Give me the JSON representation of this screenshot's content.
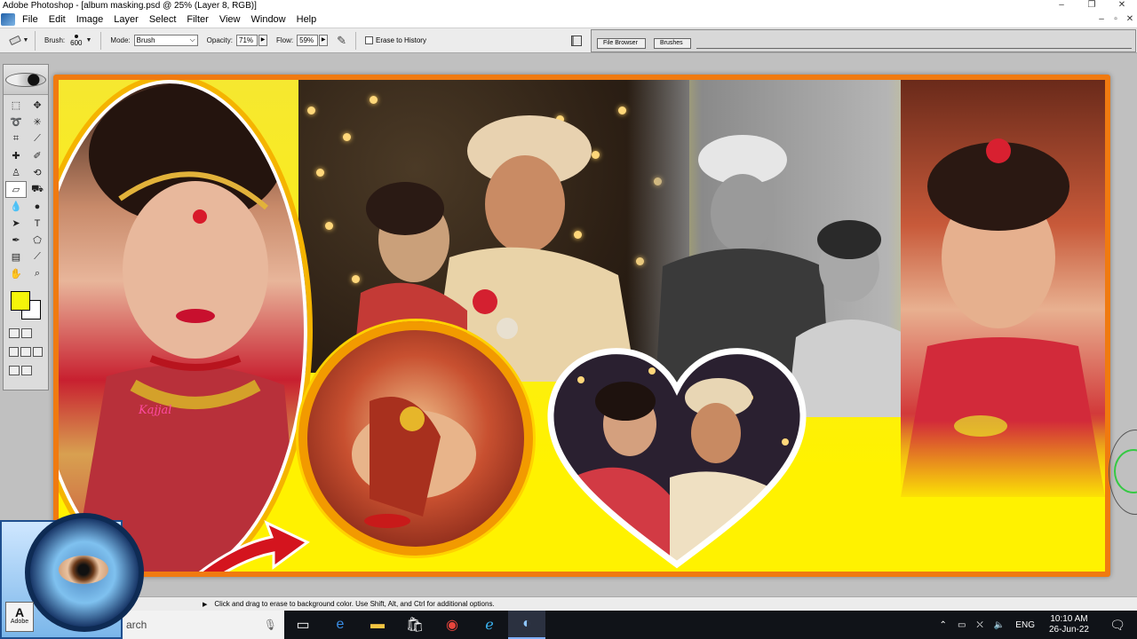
{
  "window": {
    "title": "Adobe Photoshop - [album masking.psd @ 25% (Layer 8, RGB)]",
    "controls": [
      "–",
      "❐",
      "✕"
    ]
  },
  "menu": {
    "items": [
      "File",
      "Edit",
      "Image",
      "Layer",
      "Select",
      "Filter",
      "View",
      "Window",
      "Help"
    ],
    "doc_controls": [
      "–",
      "▫",
      "✕"
    ]
  },
  "options": {
    "brush_label": "Brush:",
    "brush_size": "600",
    "mode_label": "Mode:",
    "mode_value": "Brush",
    "opacity_label": "Opacity:",
    "opacity_value": "71%",
    "flow_label": "Flow:",
    "flow_value": "59%",
    "erase_to_history_label": "Erase to History",
    "palette_tabs": [
      "File Browser",
      "Brushes"
    ]
  },
  "toolbox": {
    "foreground_color": "#f5f50a",
    "background_color": "#ffffff"
  },
  "canvas": {
    "zoom": "25%",
    "layer": "Layer 8",
    "mode": "RGB",
    "logo_text": "Kajjal"
  },
  "status": {
    "message": "Click and drag to erase to background color. Use Shift, Alt, and Ctrl for additional options."
  },
  "taskbar": {
    "search_placeholder": "arch",
    "language": "ENG",
    "time": "10:10 AM",
    "date": "26-Jun-22"
  },
  "logo": {
    "adobe_text": "Adobe"
  }
}
